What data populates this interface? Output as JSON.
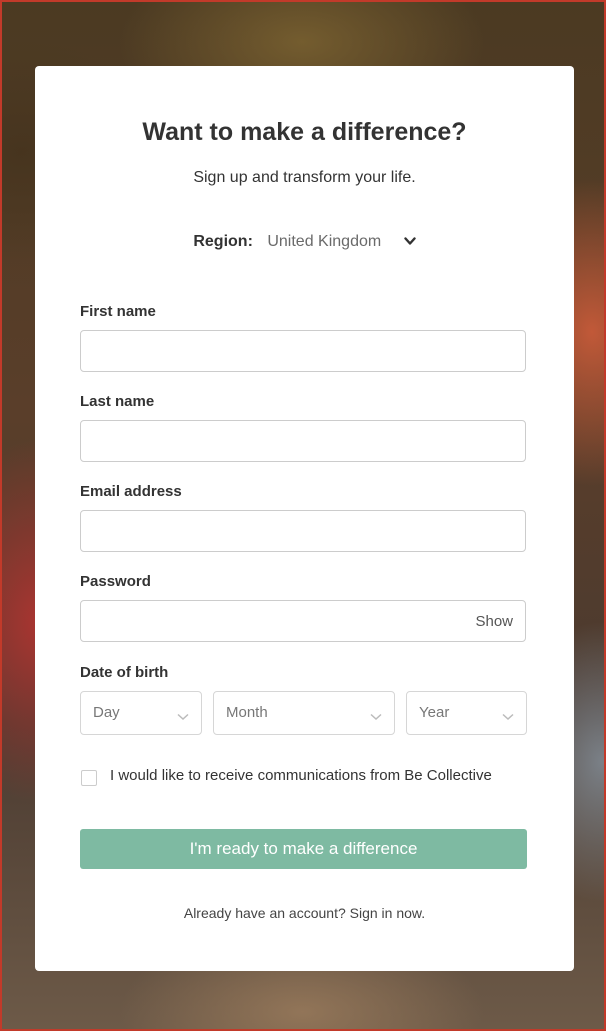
{
  "card": {
    "title": "Want to make a difference?",
    "subtitle": "Sign up and transform your life."
  },
  "region": {
    "label": "Region:",
    "value": "United Kingdom",
    "icon": "chevron-down-icon"
  },
  "fields": {
    "first_name": {
      "label": "First name",
      "value": ""
    },
    "last_name": {
      "label": "Last name",
      "value": ""
    },
    "email": {
      "label": "Email address",
      "value": ""
    },
    "password": {
      "label": "Password",
      "value": "",
      "show_label": "Show"
    }
  },
  "dob": {
    "label": "Date of birth",
    "day": "Day",
    "month": "Month",
    "year": "Year"
  },
  "consent": {
    "checked": false,
    "label": "I would like to receive communications from Be Collective"
  },
  "submit": {
    "label": "I'm ready to make a difference",
    "color": "#7ebaa2"
  },
  "signin": {
    "text": "Already have an account? Sign in now."
  }
}
